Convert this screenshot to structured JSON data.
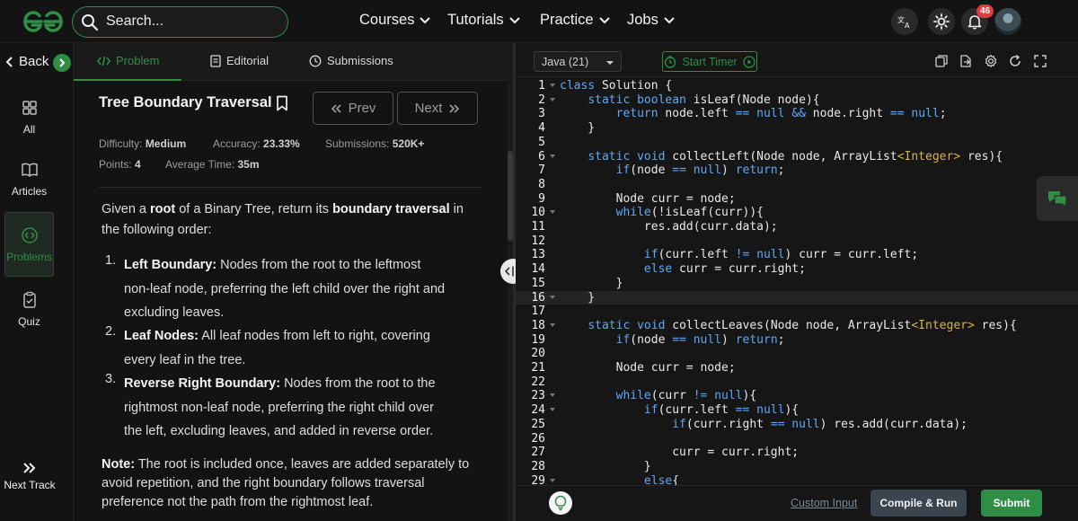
{
  "header": {
    "search_placeholder": "Search...",
    "nav": [
      "Courses",
      "Tutorials",
      "Practice",
      "Jobs"
    ],
    "notification_count": "46"
  },
  "rail": {
    "back_label": "Back",
    "items": [
      {
        "label": "All",
        "icon": "grid-icon"
      },
      {
        "label": "Articles",
        "icon": "book-icon"
      },
      {
        "label": "Problems",
        "icon": "code-file-icon"
      },
      {
        "label": "Quiz",
        "icon": "clipboard-icon"
      }
    ],
    "next_track": "Next Track"
  },
  "problem": {
    "tabs": [
      "Problem",
      "Editorial",
      "Submissions"
    ],
    "title": "Tree Boundary Traversal",
    "prev": "Prev",
    "next": "Next",
    "difficulty_label": "Difficulty:",
    "difficulty": "Medium",
    "accuracy_label": "Accuracy:",
    "accuracy": "23.33%",
    "submissions_label": "Submissions:",
    "submissions": "520K+",
    "points_label": "Points:",
    "points": "4",
    "avg_time_label": "Average Time:",
    "avg_time": "35m",
    "intro_1": "Given a ",
    "intro_root": "root",
    "intro_2": " of a Binary Tree, return its ",
    "intro_bt": "boundary traversal",
    "intro_3": " in the following order:",
    "steps": [
      {
        "num": "1.",
        "head": "Left Boundary:",
        "body": " Nodes from the root to the leftmost non-leaf node, preferring the left child over the right and excluding leaves."
      },
      {
        "num": "2.",
        "head": "Leaf Nodes:",
        "body": " All leaf nodes from left to right, covering every leaf in the tree."
      },
      {
        "num": "3.",
        "head": "Reverse Right Boundary:",
        "body": " Nodes from the root to the rightmost non-leaf node, preferring the right child over the left, excluding leaves, and added in reverse order."
      }
    ],
    "note_head": "Note:",
    "note_body": " The root is included once, leaves are added separately to avoid repetition, and the right boundary follows traversal preference not the path from the rightmost leaf."
  },
  "editor": {
    "language": "Java (21)",
    "timer_label": "Start Timer",
    "custom_input": "Custom Input",
    "compile_run": "Compile & Run",
    "submit": "Submit",
    "lines": [
      "class Solution {",
      "    static boolean isLeaf(Node node){",
      "        return node.left == null && node.right == null;",
      "    }",
      "",
      "    static void collectLeft(Node node, ArrayList<Integer> res){",
      "        if(node == null) return;",
      "",
      "        Node curr = node;",
      "        while(!isLeaf(curr)){",
      "            res.add(curr.data);",
      "",
      "            if(curr.left != null) curr = curr.left;",
      "            else curr = curr.right;",
      "        }",
      "    }",
      "",
      "    static void collectLeaves(Node node, ArrayList<Integer> res){",
      "        if(node == null) return;",
      "",
      "        Node curr = node;",
      "",
      "        while(curr != null){",
      "            if(curr.left == null){",
      "                if(curr.right == null) res.add(curr.data);",
      "",
      "                curr = curr.right;",
      "            }",
      "            else{"
    ]
  },
  "colors": {
    "accent": "#2f8d46",
    "keyword": "#5fa8f5",
    "generic": "#d6b34a",
    "badge": "#e23b3b"
  }
}
